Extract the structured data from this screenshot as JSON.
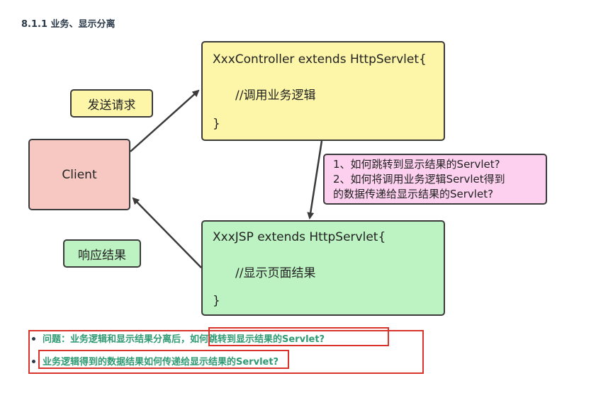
{
  "heading": "8.1.1 业务、显示分离",
  "controller": {
    "line1": "XxxController extends HttpServlet{",
    "line2": "//调用业务逻辑",
    "line3": "}"
  },
  "jsp": {
    "line1": "XxxJSP extends HttpServlet{",
    "line2": "//显示页面结果",
    "line3": "}"
  },
  "client": "Client",
  "send_label": "发送请求",
  "response_label": "响应结果",
  "note": {
    "line1": "1、如何跳转到显示结果的Servlet?",
    "line2": "2、如何将调用业务逻辑Servlet得到",
    "line3": "的数据传递给显示结果的Servlet?"
  },
  "questions": [
    "问题：业务逻辑和显示结果分离后，如何跳转到显示结果的Servlet?",
    "业务逻辑得到的数据结果如何传递给显示结果的Servlet?"
  ]
}
